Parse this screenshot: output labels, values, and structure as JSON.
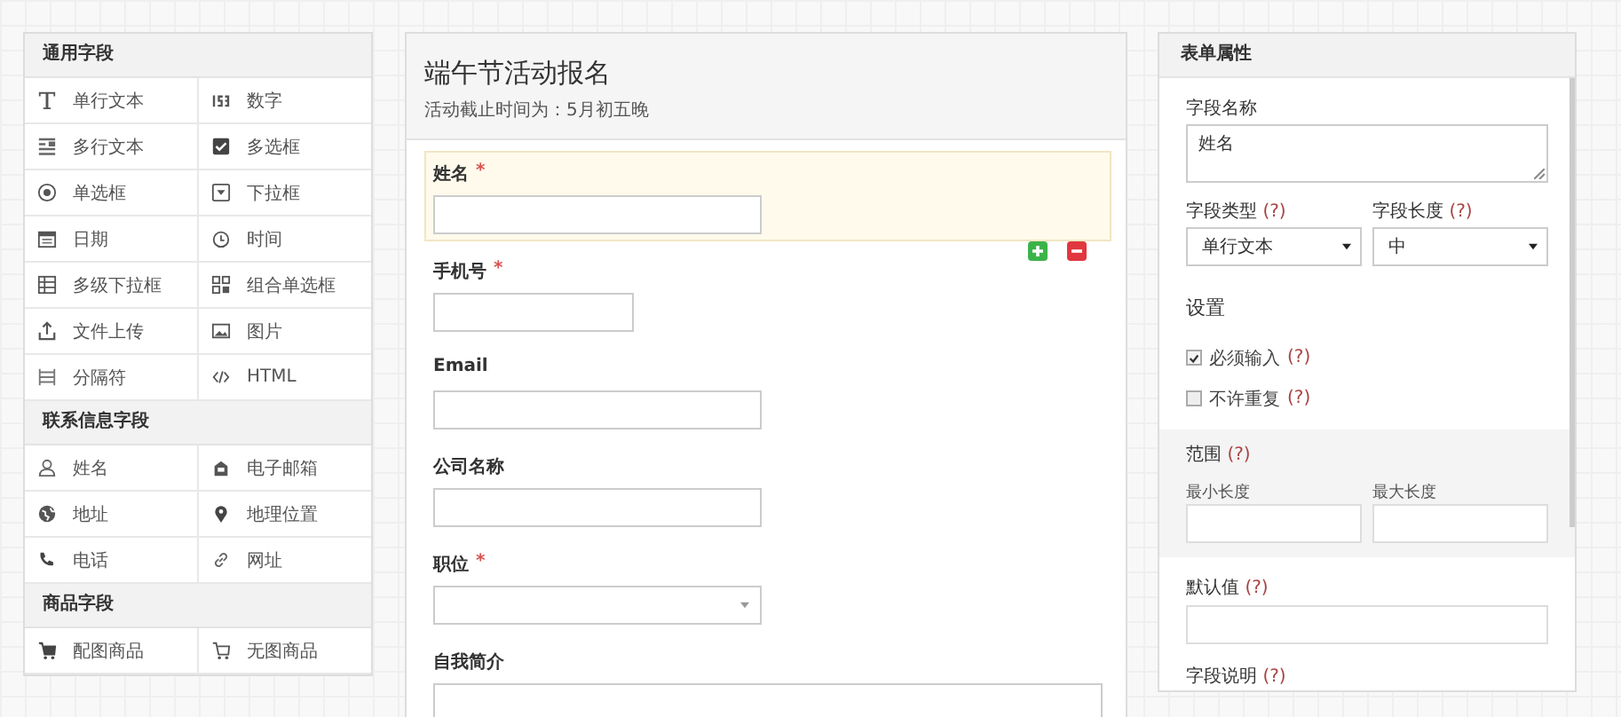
{
  "palette": {
    "groups": [
      {
        "title": "通用字段",
        "items": [
          {
            "kind": "text",
            "label": "单行文本"
          },
          {
            "kind": "number",
            "label": "数字"
          },
          {
            "kind": "textarea",
            "label": "多行文本"
          },
          {
            "kind": "checkbox",
            "label": "多选框"
          },
          {
            "kind": "radio",
            "label": "单选框"
          },
          {
            "kind": "dropdown",
            "label": "下拉框"
          },
          {
            "kind": "date",
            "label": "日期"
          },
          {
            "kind": "time",
            "label": "时间"
          },
          {
            "kind": "cascade",
            "label": "多级下拉框"
          },
          {
            "kind": "radio-group",
            "label": "组合单选框"
          },
          {
            "kind": "upload",
            "label": "文件上传"
          },
          {
            "kind": "image",
            "label": "图片"
          },
          {
            "kind": "divider",
            "label": "分隔符"
          },
          {
            "kind": "html",
            "label": "HTML"
          }
        ]
      },
      {
        "title": "联系信息字段",
        "items": [
          {
            "kind": "name",
            "label": "姓名"
          },
          {
            "kind": "email",
            "label": "电子邮箱"
          },
          {
            "kind": "address",
            "label": "地址"
          },
          {
            "kind": "location",
            "label": "地理位置"
          },
          {
            "kind": "phone",
            "label": "电话"
          },
          {
            "kind": "url",
            "label": "网址"
          }
        ]
      },
      {
        "title": "商品字段",
        "items": [
          {
            "kind": "product-image",
            "label": "配图商品"
          },
          {
            "kind": "product",
            "label": "无图商品"
          }
        ]
      }
    ]
  },
  "form": {
    "title": "端午节活动报名",
    "subtitle": "活动截止时间为：5月初五晚",
    "required_mark": "*",
    "fields": [
      {
        "kind": "text",
        "label": "姓名",
        "required": true,
        "selected": true
      },
      {
        "kind": "phone",
        "label": "手机号",
        "required": true,
        "selected": false
      },
      {
        "kind": "email",
        "label": "Email",
        "required": false,
        "selected": false
      },
      {
        "kind": "text",
        "label": "公司名称",
        "required": false,
        "selected": false
      },
      {
        "kind": "select",
        "label": "职位",
        "required": true,
        "selected": false
      },
      {
        "kind": "textarea",
        "label": "自我简介",
        "required": false,
        "selected": false
      }
    ]
  },
  "properties": {
    "title": "表单属性",
    "help": "(?)",
    "field_name": {
      "label": "字段名称",
      "value": "姓名"
    },
    "field_type": {
      "label": "字段类型",
      "value": "单行文本"
    },
    "field_length": {
      "label": "字段长度",
      "value": "中"
    },
    "settings_title": "设置",
    "settings": [
      {
        "label": "必须输入",
        "checked": true
      },
      {
        "label": "不许重复",
        "checked": false
      }
    ],
    "range": {
      "label": "范围",
      "min_label": "最小长度",
      "max_label": "最大长度"
    },
    "default_value": {
      "label": "默认值"
    },
    "description": {
      "label": "字段说明"
    }
  }
}
